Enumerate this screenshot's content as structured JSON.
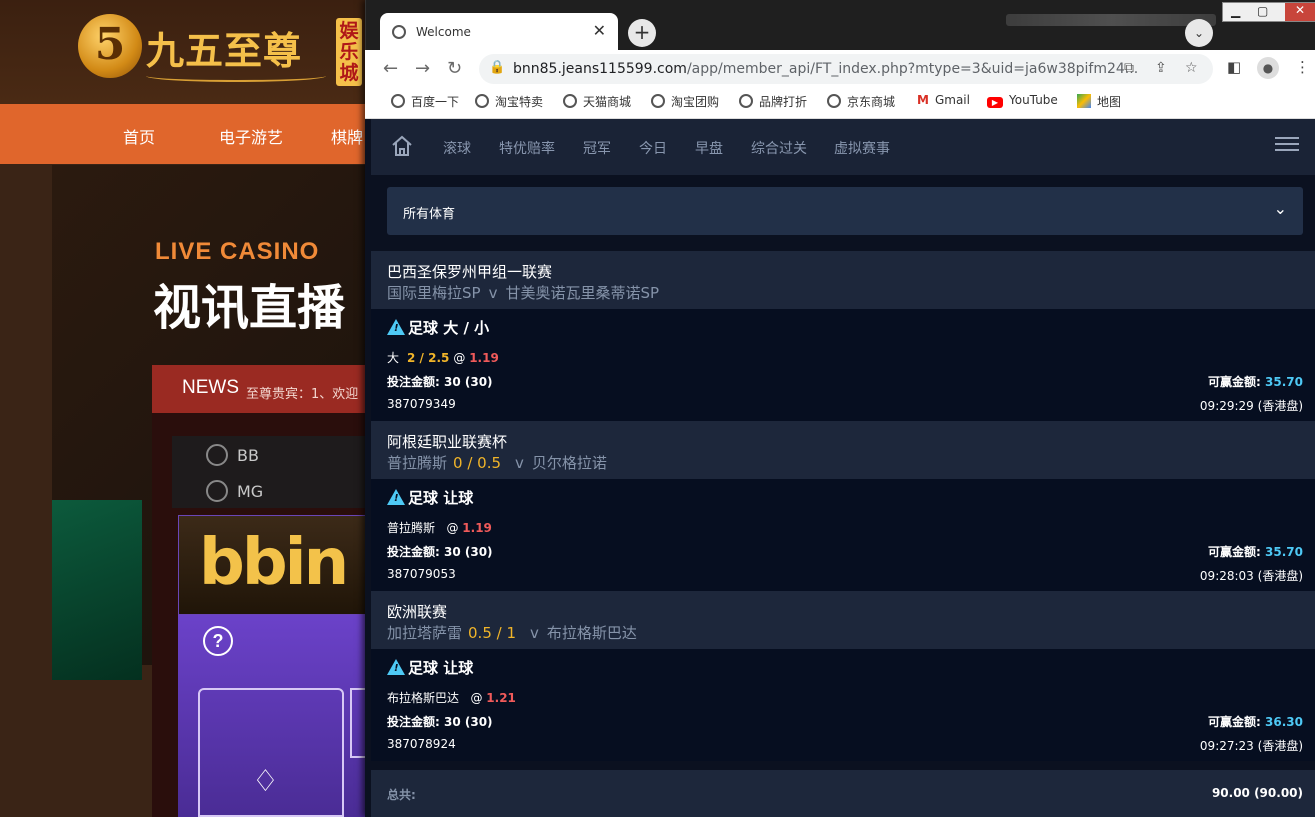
{
  "background_site": {
    "logo_digit": "5",
    "logo_text": "九五至尊",
    "logo_badge": "娱乐城",
    "nav": [
      "首页",
      "电子游艺",
      "棋牌"
    ],
    "live_casino": "LIVE CASINO",
    "live_casino_cn": "视讯直播",
    "news_label": "NEWS",
    "news_marquee": "至尊贵宾：1、欢迎",
    "providers": [
      "BB",
      "MG"
    ],
    "bbin_logo": "bbin",
    "help_icon": "?"
  },
  "browser": {
    "tab_title": "Welcome",
    "url_host": "bnn85.jeans115599.com",
    "url_path": "/app/member_api/FT_index.php?mtype=3&uid=ja6w38pifm24...",
    "bookmarks": [
      {
        "label": "百度一下",
        "icon": "globe-icon"
      },
      {
        "label": "淘宝特卖",
        "icon": "globe-icon"
      },
      {
        "label": "天猫商城",
        "icon": "globe-icon"
      },
      {
        "label": "淘宝团购",
        "icon": "globe-icon"
      },
      {
        "label": "品牌打折",
        "icon": "globe-icon"
      },
      {
        "label": "京东商城",
        "icon": "globe-icon"
      },
      {
        "label": "Gmail",
        "icon": "gmail-icon"
      },
      {
        "label": "YouTube",
        "icon": "youtube-icon"
      },
      {
        "label": "地图",
        "icon": "maps-icon"
      }
    ]
  },
  "app": {
    "nav_items": [
      "滚球",
      "特优赔率",
      "冠军",
      "今日",
      "早盘",
      "综合过关",
      "虚拟赛事"
    ],
    "sport_select": "所有体育",
    "bets": [
      {
        "league": "巴西圣保罗州甲组一联赛",
        "home": "国际里梅拉SP",
        "handicap": "",
        "vs": "v",
        "away": "甘美奥诺瓦里桑蒂诺SP",
        "bet_type": "足球 大 / 小",
        "selection": "大",
        "line": "2 / 2.5",
        "at": "@",
        "odds": "1.19",
        "amount_label": "投注金额:",
        "amount": "30 (30)",
        "win_label": "可赢金额:",
        "win": "35.70",
        "ticket": "387079349",
        "time": "09:29:29 (香港盘)"
      },
      {
        "league": "阿根廷职业联赛杯",
        "home": "普拉腾斯",
        "handicap": "0 / 0.5",
        "vs": "v",
        "away": "贝尔格拉诺",
        "bet_type": "足球 让球",
        "selection": "普拉腾斯",
        "line": "",
        "at": "@",
        "odds": "1.19",
        "amount_label": "投注金额:",
        "amount": "30 (30)",
        "win_label": "可赢金额:",
        "win": "35.70",
        "ticket": "387079053",
        "time": "09:28:03 (香港盘)"
      },
      {
        "league": "欧洲联赛",
        "home": "加拉塔萨雷",
        "handicap": "0.5 / 1",
        "vs": "v",
        "away": "布拉格斯巴达",
        "bet_type": "足球 让球",
        "selection": "布拉格斯巴达",
        "line": "",
        "at": "@",
        "odds": "1.21",
        "amount_label": "投注金额:",
        "amount": "30 (30)",
        "win_label": "可赢金额:",
        "win": "36.30",
        "ticket": "387078924",
        "time": "09:27:23 (香港盘)"
      }
    ],
    "total_label": "总共:",
    "total_value": "90.00 (90.00)"
  },
  "colors": {
    "accent_win": "#4ec9f5",
    "odds": "#f05a5a",
    "handicap": "#f0b429",
    "page_bg": "#0b1120"
  }
}
